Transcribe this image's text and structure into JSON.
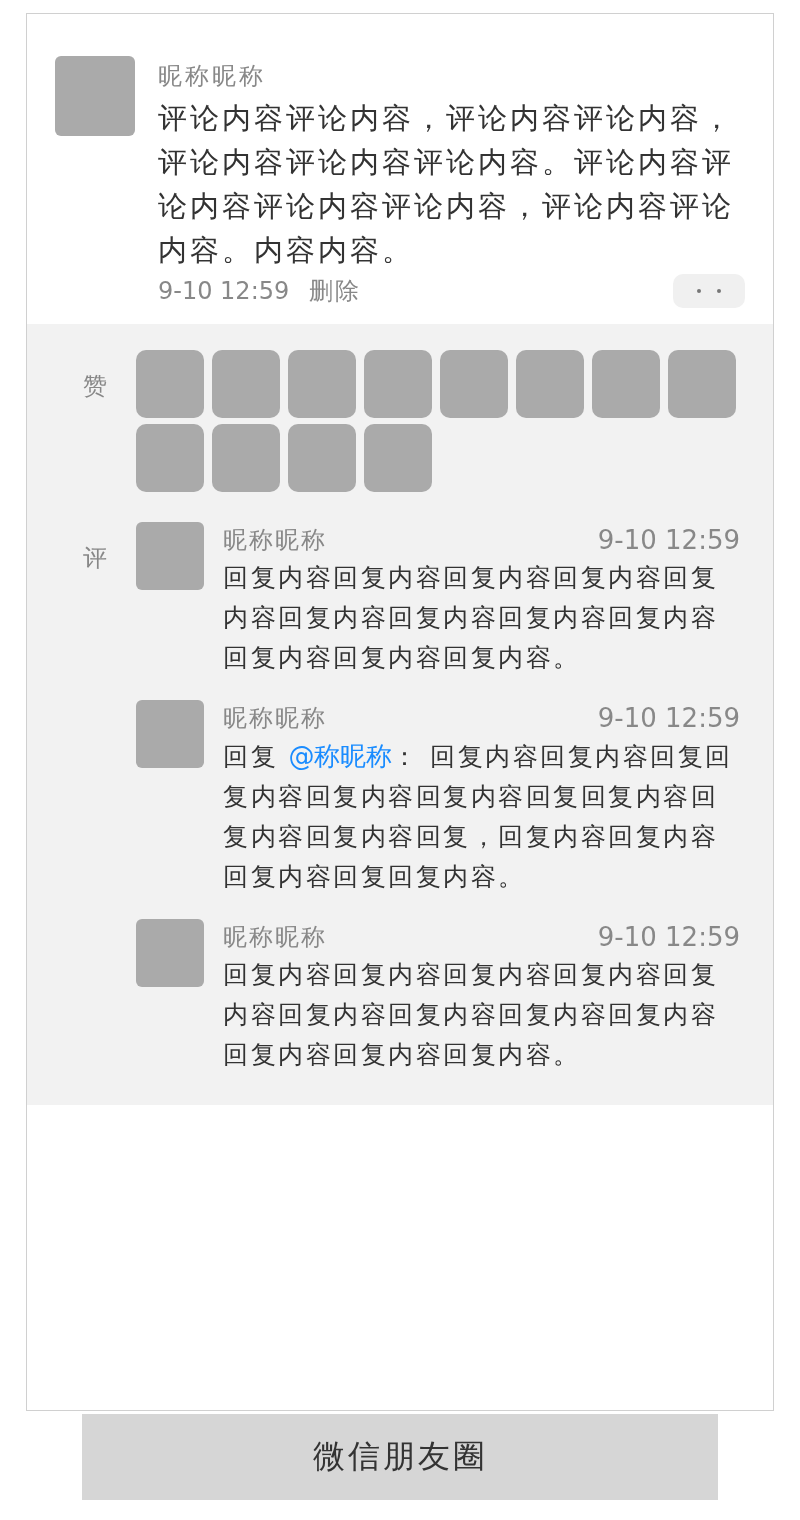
{
  "post": {
    "name": "昵称昵称",
    "content": "评论内容评论内容，评论内容评论内容，评论内容评论内容评论内容。评论内容评论内容评论内容评论内容，评论内容评论内容。内容内容。",
    "time": "9-10 12:59",
    "delete": "删除"
  },
  "likes": {
    "label": "赞",
    "users": [
      {
        "kind": "avatar"
      },
      {
        "kind": "avatar"
      },
      {
        "kind": "avatar"
      },
      {
        "kind": "avatar"
      },
      {
        "kind": "avatar"
      },
      {
        "kind": "avatar"
      },
      {
        "kind": "avatar"
      },
      {
        "kind": "avatar"
      },
      {
        "kind": "avatar"
      },
      {
        "kind": "avatar"
      },
      {
        "kind": "avatar"
      },
      {
        "kind": "avatar"
      }
    ]
  },
  "comments": {
    "label": "评",
    "items": [
      {
        "kind": "comment",
        "name": "昵称昵称",
        "time": "9-10 12:59",
        "content": "回复内容回复内容回复内容回复内容回复内容回复内容回复内容回复内容回复内容回复内容回复内容回复内容。"
      },
      {
        "kind": "reply",
        "name": "昵称昵称",
        "time": "9-10 12:59",
        "prefix": "回复",
        "mention": "@称昵称",
        "content": "： 回复内容回复内容回复回复内容回复内容回复内容回复回复内容回复内容回复内容回复，回复内容回复内容回复内容回复回复内容。"
      },
      {
        "kind": "comment",
        "name": "昵称昵称",
        "time": "9-10 12:59",
        "content": "回复内容回复内容回复内容回复内容回复内容回复内容回复内容回复内容回复内容回复内容回复内容回复内容。"
      }
    ]
  },
  "footer": {
    "title": "微信朋友圈"
  }
}
